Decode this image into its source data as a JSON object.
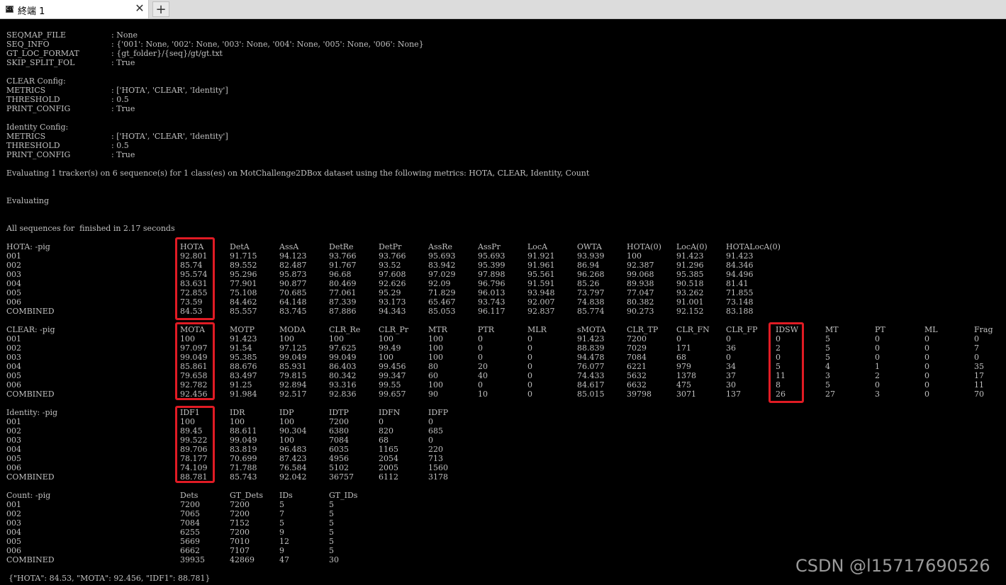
{
  "window": {
    "tab_title": "終端 1",
    "tab_icon_glyph": "C:\\",
    "close_glyph": "✕",
    "new_tab_glyph": "+"
  },
  "config_lines": [
    {
      "key": "SEQMAP_FILE",
      "value": ": None"
    },
    {
      "key": "SEQ_INFO",
      "value": ": {'001': None, '002': None, '003': None, '004': None, '005': None, '006': None}"
    },
    {
      "key": "GT_LOC_FORMAT",
      "value": ": {gt_folder}/{seq}/gt/gt.txt"
    },
    {
      "key": "SKIP_SPLIT_FOL",
      "value": ": True"
    },
    {
      "key": "",
      "value": ""
    },
    {
      "key": "CLEAR Config:",
      "value": ""
    },
    {
      "key": "METRICS",
      "value": ": ['HOTA', 'CLEAR', 'Identity']"
    },
    {
      "key": "THRESHOLD",
      "value": ": 0.5"
    },
    {
      "key": "PRINT_CONFIG",
      "value": ": True"
    },
    {
      "key": "",
      "value": ""
    },
    {
      "key": "Identity Config:",
      "value": ""
    },
    {
      "key": "METRICS",
      "value": ": ['HOTA', 'CLEAR', 'Identity']"
    },
    {
      "key": "THRESHOLD",
      "value": ": 0.5"
    },
    {
      "key": "PRINT_CONFIG",
      "value": ": True"
    }
  ],
  "evaluating_line": "Evaluating 1 tracker(s) on 6 sequence(s) for 1 class(es) on MotChallenge2DBox dataset using the following metrics: HOTA, CLEAR, Identity, Count",
  "evaluating_label": "Evaluating",
  "finished_line": "All sequences for  finished in 2.17 seconds",
  "tables": [
    {
      "id": "hota",
      "title": "HOTA: -pig",
      "columns": [
        "HOTA",
        "DetA",
        "AssA",
        "DetRe",
        "DetPr",
        "AssRe",
        "AssPr",
        "LocA",
        "OWTA",
        "HOTA(0)",
        "LocA(0)",
        "HOTALocA(0)"
      ],
      "rows": [
        {
          "label": "001",
          "values": [
            "92.801",
            "91.715",
            "94.123",
            "93.766",
            "93.766",
            "95.693",
            "95.693",
            "91.921",
            "93.939",
            "100",
            "91.423",
            "91.423"
          ]
        },
        {
          "label": "002",
          "values": [
            "85.74",
            "89.552",
            "82.487",
            "91.767",
            "93.52",
            "83.942",
            "95.399",
            "91.961",
            "86.94",
            "92.387",
            "91.296",
            "84.346"
          ]
        },
        {
          "label": "003",
          "values": [
            "95.574",
            "95.296",
            "95.873",
            "96.68",
            "97.608",
            "97.029",
            "97.898",
            "95.561",
            "96.268",
            "99.068",
            "95.385",
            "94.496"
          ]
        },
        {
          "label": "004",
          "values": [
            "83.631",
            "77.901",
            "90.877",
            "80.469",
            "92.626",
            "92.09",
            "96.796",
            "91.591",
            "85.26",
            "89.938",
            "90.518",
            "81.41"
          ]
        },
        {
          "label": "005",
          "values": [
            "72.855",
            "75.108",
            "70.685",
            "77.061",
            "95.29",
            "71.829",
            "96.013",
            "93.948",
            "73.797",
            "77.047",
            "93.262",
            "71.855"
          ]
        },
        {
          "label": "006",
          "values": [
            "73.59",
            "84.462",
            "64.148",
            "87.339",
            "93.173",
            "65.467",
            "93.743",
            "92.007",
            "74.838",
            "80.382",
            "91.001",
            "73.148"
          ]
        },
        {
          "label": "COMBINED",
          "values": [
            "84.53",
            "85.557",
            "83.745",
            "87.886",
            "94.343",
            "85.053",
            "96.117",
            "92.837",
            "85.774",
            "90.273",
            "92.152",
            "83.188"
          ]
        }
      ]
    },
    {
      "id": "clear",
      "title": "CLEAR: -pig",
      "columns": [
        "MOTA",
        "MOTP",
        "MODA",
        "CLR_Re",
        "CLR_Pr",
        "MTR",
        "PTR",
        "MLR",
        "sMOTA",
        "CLR_TP",
        "CLR_FN",
        "CLR_FP",
        "IDSW",
        "MT",
        "PT",
        "ML",
        "Frag"
      ],
      "rows": [
        {
          "label": "001",
          "values": [
            "100",
            "91.423",
            "100",
            "100",
            "100",
            "100",
            "0",
            "0",
            "91.423",
            "7200",
            "0",
            "0",
            "0",
            "5",
            "0",
            "0",
            "0"
          ]
        },
        {
          "label": "002",
          "values": [
            "97.097",
            "91.54",
            "97.125",
            "97.625",
            "99.49",
            "100",
            "0",
            "0",
            "88.839",
            "7029",
            "171",
            "36",
            "2",
            "5",
            "0",
            "0",
            "7"
          ]
        },
        {
          "label": "003",
          "values": [
            "99.049",
            "95.385",
            "99.049",
            "99.049",
            "100",
            "100",
            "0",
            "0",
            "94.478",
            "7084",
            "68",
            "0",
            "0",
            "5",
            "0",
            "0",
            "0"
          ]
        },
        {
          "label": "004",
          "values": [
            "85.861",
            "88.676",
            "85.931",
            "86.403",
            "99.456",
            "80",
            "20",
            "0",
            "76.077",
            "6221",
            "979",
            "34",
            "5",
            "4",
            "1",
            "0",
            "35"
          ]
        },
        {
          "label": "005",
          "values": [
            "79.658",
            "83.497",
            "79.815",
            "80.342",
            "99.347",
            "60",
            "40",
            "0",
            "74.433",
            "5632",
            "1378",
            "37",
            "11",
            "3",
            "2",
            "0",
            "17"
          ]
        },
        {
          "label": "006",
          "values": [
            "92.782",
            "91.25",
            "92.894",
            "93.316",
            "99.55",
            "100",
            "0",
            "0",
            "84.617",
            "6632",
            "475",
            "30",
            "8",
            "5",
            "0",
            "0",
            "11"
          ]
        },
        {
          "label": "COMBINED",
          "values": [
            "92.456",
            "91.984",
            "92.517",
            "92.836",
            "99.657",
            "90",
            "10",
            "0",
            "85.015",
            "39798",
            "3071",
            "137",
            "26",
            "27",
            "3",
            "0",
            "70"
          ]
        }
      ]
    },
    {
      "id": "identity",
      "title": "Identity: -pig",
      "columns": [
        "IDF1",
        "IDR",
        "IDP",
        "IDTP",
        "IDFN",
        "IDFP"
      ],
      "rows": [
        {
          "label": "001",
          "values": [
            "100",
            "100",
            "100",
            "7200",
            "0",
            "0"
          ]
        },
        {
          "label": "002",
          "values": [
            "89.45",
            "88.611",
            "90.304",
            "6380",
            "820",
            "685"
          ]
        },
        {
          "label": "003",
          "values": [
            "99.522",
            "99.049",
            "100",
            "7084",
            "68",
            "0"
          ]
        },
        {
          "label": "004",
          "values": [
            "89.706",
            "83.819",
            "96.483",
            "6035",
            "1165",
            "220"
          ]
        },
        {
          "label": "005",
          "values": [
            "78.177",
            "70.699",
            "87.423",
            "4956",
            "2054",
            "713"
          ]
        },
        {
          "label": "006",
          "values": [
            "74.109",
            "71.788",
            "76.584",
            "5102",
            "2005",
            "1560"
          ]
        },
        {
          "label": "COMBINED",
          "values": [
            "88.781",
            "85.743",
            "92.042",
            "36757",
            "6112",
            "3178"
          ]
        }
      ]
    },
    {
      "id": "count",
      "title": "Count: -pig",
      "columns": [
        "Dets",
        "GT_Dets",
        "IDs",
        "GT_IDs"
      ],
      "rows": [
        {
          "label": "001",
          "values": [
            "7200",
            "7200",
            "5",
            "5"
          ]
        },
        {
          "label": "002",
          "values": [
            "7065",
            "7200",
            "7",
            "5"
          ]
        },
        {
          "label": "003",
          "values": [
            "7084",
            "7152",
            "5",
            "5"
          ]
        },
        {
          "label": "004",
          "values": [
            "6255",
            "7200",
            "9",
            "5"
          ]
        },
        {
          "label": "005",
          "values": [
            "5669",
            "7010",
            "12",
            "5"
          ]
        },
        {
          "label": "006",
          "values": [
            "6662",
            "7107",
            "9",
            "5"
          ]
        },
        {
          "label": "COMBINED",
          "values": [
            "39935",
            "42869",
            "47",
            "30"
          ]
        }
      ]
    }
  ],
  "summary_line": "{\"HOTA\": 84.53, \"MOTA\": 92.456, \"IDF1\": 88.781}",
  "watermark": "CSDN @l15717690526",
  "colors": {
    "highlight": "#e01b24",
    "terminal_bg": "#000000",
    "terminal_text": "#c0c0c0"
  }
}
